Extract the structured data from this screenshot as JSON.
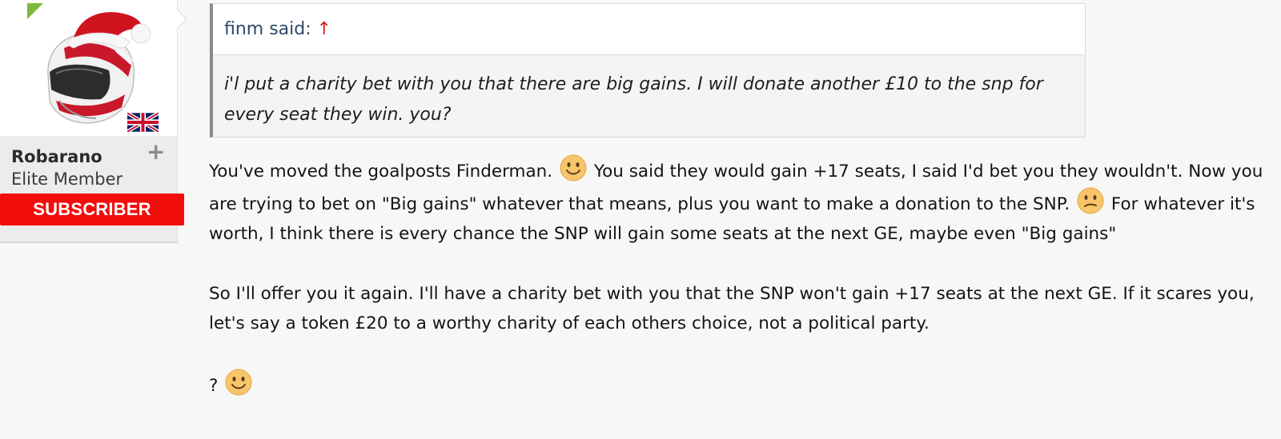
{
  "user": {
    "name": "Robarano",
    "title": "Elite Member",
    "badge": "SUBSCRIBER",
    "follow_icon": "plus-icon",
    "flag_icon": "uk-flag-icon"
  },
  "quote": {
    "author": "finm said:",
    "jump_icon": "↑",
    "text": "i'l put a charity bet with you that there are big gains. I will donate another £10 to the snp for every seat they win. you?"
  },
  "post": {
    "p1_a": "You've moved the goalposts Finderman.",
    "p1_b": "You said they would gain +17 seats, I said I'd bet you they wouldn't. Now you are trying to bet on \"Big gains\" whatever that means, plus you want to make a donation to the SNP.",
    "p1_c": "For whatever it's worth, I think there is every chance the SNP will gain some seats at the next GE, maybe even \"Big gains\"",
    "p2": "So I'll offer you it again. I'll have a charity bet with you that the SNP won't gain +17 seats at the next GE. If it scares you, let's say a token £20 to a worthy charity of each others choice, not a political party.",
    "p3": "?"
  },
  "colors": {
    "subscriber_bg": "#f20d0d",
    "online_indicator": "#7fb83b",
    "quote_author": "#2e4a66",
    "quote_arrow": "#d21e1e"
  }
}
